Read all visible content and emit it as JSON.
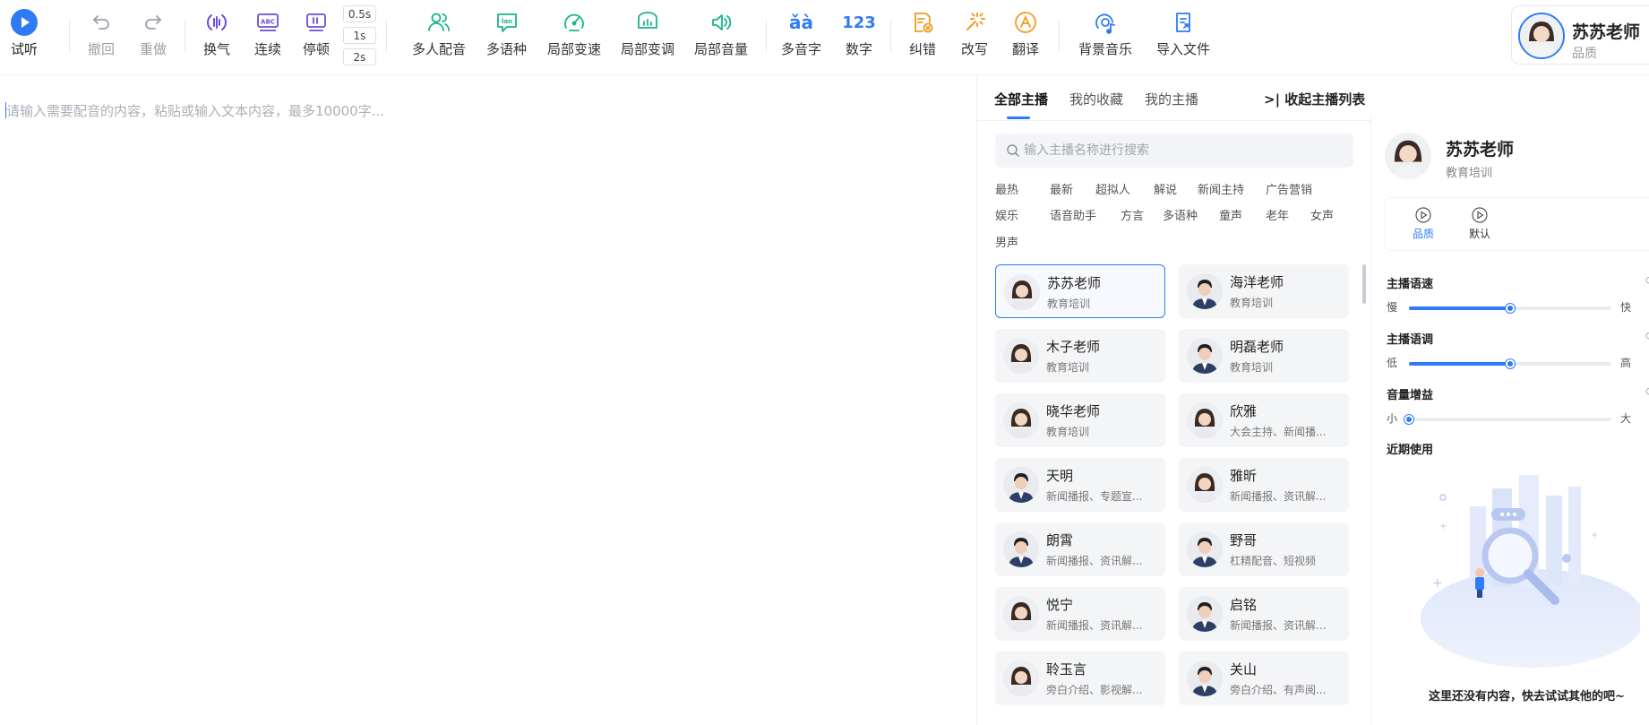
{
  "colors": {
    "accent": "#2f7bf6",
    "purple": "#6b4cd8",
    "green": "#19b58a",
    "orange": "#f29b1d"
  },
  "toolbar": {
    "play": {
      "label": "试听",
      "icon": "play-icon"
    },
    "undo": {
      "label": "撤回",
      "icon": "undo-icon"
    },
    "redo": {
      "label": "重做",
      "icon": "redo-icon"
    },
    "breath": {
      "label": "换气",
      "icon": "breath-icon"
    },
    "continuous": {
      "label": "连续",
      "icon": "abc-icon"
    },
    "pause": {
      "label": "停顿",
      "icon": "pause-icon",
      "options": [
        "0.5s",
        "1s",
        "2s"
      ]
    },
    "multi_voice": {
      "label": "多人配音",
      "icon": "users-icon"
    },
    "multi_lang": {
      "label": "多语种",
      "icon": "language-icon"
    },
    "local_speed": {
      "label": "局部变速",
      "icon": "speedometer-icon"
    },
    "local_pitch": {
      "label": "局部变调",
      "icon": "pitch-icon"
    },
    "local_volume": {
      "label": "局部音量",
      "icon": "volume-icon"
    },
    "polyphone": {
      "label": "多音字",
      "glyph": "ǎà",
      "icon": "polyphone-icon"
    },
    "number": {
      "label": "数字",
      "glyph": "123",
      "icon": "number-icon"
    },
    "correct": {
      "label": "纠错",
      "icon": "correct-icon"
    },
    "rewrite": {
      "label": "改写",
      "icon": "rewrite-icon"
    },
    "translate": {
      "label": "翻译",
      "icon": "translate-icon"
    },
    "bgm": {
      "label": "背景音乐",
      "icon": "music-icon"
    },
    "import": {
      "label": "导入文件",
      "icon": "import-file-icon"
    }
  },
  "profile": {
    "name": "苏苏老师",
    "subtitle": "品质"
  },
  "editor": {
    "placeholder": "请输入需要配音的内容，粘贴或输入文本内容，最多10000字..."
  },
  "voice_list": {
    "tabs": [
      "全部主播",
      "我的收藏",
      "我的主播"
    ],
    "active_tab": 0,
    "collapse_label": "收起主播列表",
    "search_placeholder": "输入主播名称进行搜索",
    "categories": [
      "最热",
      "最新",
      "超拟人",
      "解说",
      "新闻主持",
      "广告营销",
      "娱乐",
      "语音助手",
      "方言",
      "多语种",
      "童声",
      "老年",
      "女声",
      "男声"
    ],
    "voices": [
      {
        "name": "苏苏老师",
        "tags": "教育培训",
        "gender": "f",
        "selected": true
      },
      {
        "name": "海洋老师",
        "tags": "教育培训",
        "gender": "m"
      },
      {
        "name": "木子老师",
        "tags": "教育培训",
        "gender": "f"
      },
      {
        "name": "明磊老师",
        "tags": "教育培训",
        "gender": "m"
      },
      {
        "name": "晓华老师",
        "tags": "教育培训",
        "gender": "f"
      },
      {
        "name": "欣雅",
        "tags": "大会主持、新闻播...",
        "gender": "f"
      },
      {
        "name": "天明",
        "tags": "新闻播报、专题宣...",
        "gender": "m"
      },
      {
        "name": "雅昕",
        "tags": "新闻播报、资讯解...",
        "gender": "f"
      },
      {
        "name": "朗霄",
        "tags": "新闻播报、资讯解...",
        "gender": "m"
      },
      {
        "name": "野哥",
        "tags": "杠精配音、短视频",
        "gender": "m"
      },
      {
        "name": "悦宁",
        "tags": "新闻播报、资讯解...",
        "gender": "f"
      },
      {
        "name": "启铭",
        "tags": "新闻播报、资讯解...",
        "gender": "m"
      },
      {
        "name": "聆玉言",
        "tags": "旁白介绍、影视解...",
        "gender": "f"
      },
      {
        "name": "关山",
        "tags": "旁白介绍、有声阅...",
        "gender": "m"
      }
    ]
  },
  "detail": {
    "name": "苏苏老师",
    "subtitle": "教育培训",
    "styles": [
      {
        "label": "品质",
        "active": true
      },
      {
        "label": "默认",
        "active": false
      }
    ],
    "speed": {
      "title": "主播语速",
      "min_label": "慢",
      "max_label": "快",
      "value": 0.5
    },
    "pitch": {
      "title": "主播语调",
      "min_label": "低",
      "max_label": "高",
      "value": 0.5
    },
    "volume": {
      "title": "音量增益",
      "min_label": "小",
      "max_label": "大",
      "value": 0.0
    },
    "recent_title": "近期使用",
    "empty_text": "这里还没有内容，快去试试其他的吧~"
  }
}
